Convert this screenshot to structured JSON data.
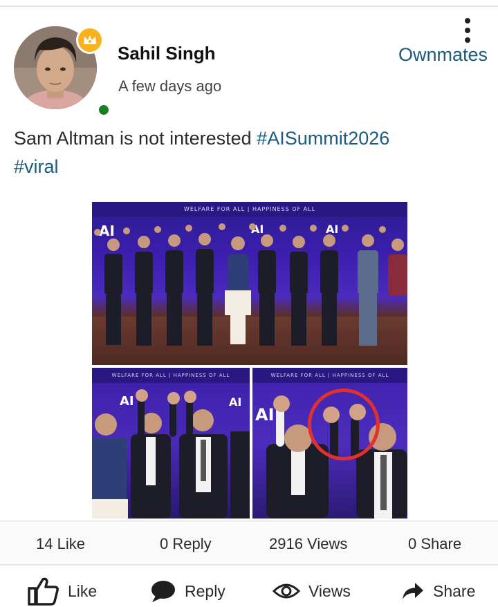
{
  "post": {
    "author": "Sahil Singh",
    "time": "A few days ago",
    "community": "Ownmates",
    "text": "Sam Altman is not interested ",
    "hashtags": [
      "#AISummit2026",
      "#viral"
    ]
  },
  "image": {
    "banner_text": "WELFARE FOR ALL | HAPPINESS OF ALL",
    "logo_text": "AI"
  },
  "stats": {
    "likes": "14 Like",
    "replies": "0 Reply",
    "views": "2916 Views",
    "shares": "0 Share"
  },
  "actions": {
    "like": "Like",
    "reply": "Reply",
    "views": "Views",
    "share": "Share"
  },
  "colors": {
    "link": "#1b5b7f",
    "online": "#1a7f22",
    "badge": "#f7b21e",
    "highlight": "#e0312c"
  },
  "icons": [
    "crown-icon",
    "more-vertical-icon",
    "thumbs-up-icon",
    "comment-icon",
    "eye-icon",
    "share-arrow-icon"
  ]
}
